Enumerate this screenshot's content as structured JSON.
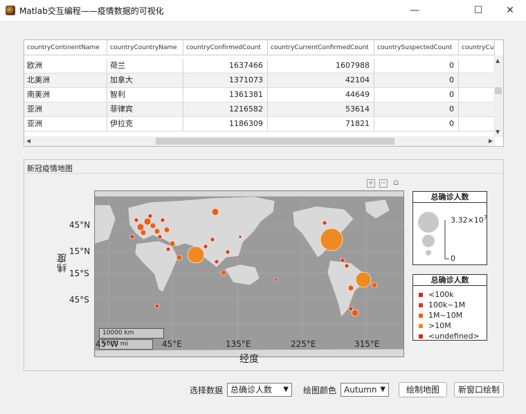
{
  "window": {
    "title": "Matlab交互编程——疫情数据的可视化",
    "minimize": "—",
    "maximize": "☐",
    "close": "✕"
  },
  "table": {
    "columns": [
      "countryContinentName",
      "countryCountryName",
      "countryConfirmedCount",
      "countryCurrentConfirmedCount",
      "countrySuspectedCount",
      "countryCu"
    ],
    "rows": [
      [
        "欧洲",
        "荷兰",
        "1637466",
        "1607988",
        "0"
      ],
      [
        "北美洲",
        "加拿大",
        "1371073",
        "42104",
        "0"
      ],
      [
        "南美洲",
        "智利",
        "1361381",
        "44649",
        "0"
      ],
      [
        "亚洲",
        "菲律宾",
        "1216582",
        "53614",
        "0"
      ],
      [
        "亚洲",
        "伊拉克",
        "1186309",
        "71821",
        "0"
      ]
    ]
  },
  "map_panel": {
    "title": "新冠疫情地图",
    "y_ticks": [
      "45°N",
      "15°N",
      "15°S",
      "45°S"
    ],
    "x_ticks": [
      "45°W",
      "45°E",
      "135°E",
      "225°E",
      "315°E"
    ],
    "xlabel": "经度",
    "ylabel": "纬度",
    "scale_km": "10000 km",
    "scale_mi": "5000 mi",
    "toolbar_icons": [
      "zoom-in-icon",
      "zoom-out-icon",
      "home-icon"
    ]
  },
  "size_legend": {
    "title": "总确诊人数",
    "max_label": "3.32×10",
    "max_exp": "7",
    "min_label": "0"
  },
  "color_legend": {
    "title": "总确诊人数",
    "items": [
      {
        "label": "<100k",
        "color": "#d9261c"
      },
      {
        "label": "100k~1M",
        "color": "#e03a1a"
      },
      {
        "label": "1M~10M",
        "color": "#ec5f18"
      },
      {
        "label": ">10M",
        "color": "#f08a20"
      },
      {
        "label": "<undefined>",
        "color": "#d9261c"
      }
    ]
  },
  "controls": {
    "data_label": "选择数据",
    "data_value": "总确诊人数",
    "color_label": "绘图颜色",
    "color_value": "Autumn",
    "draw_button": "绘制地图",
    "new_window_button": "新窗口绘制"
  }
}
